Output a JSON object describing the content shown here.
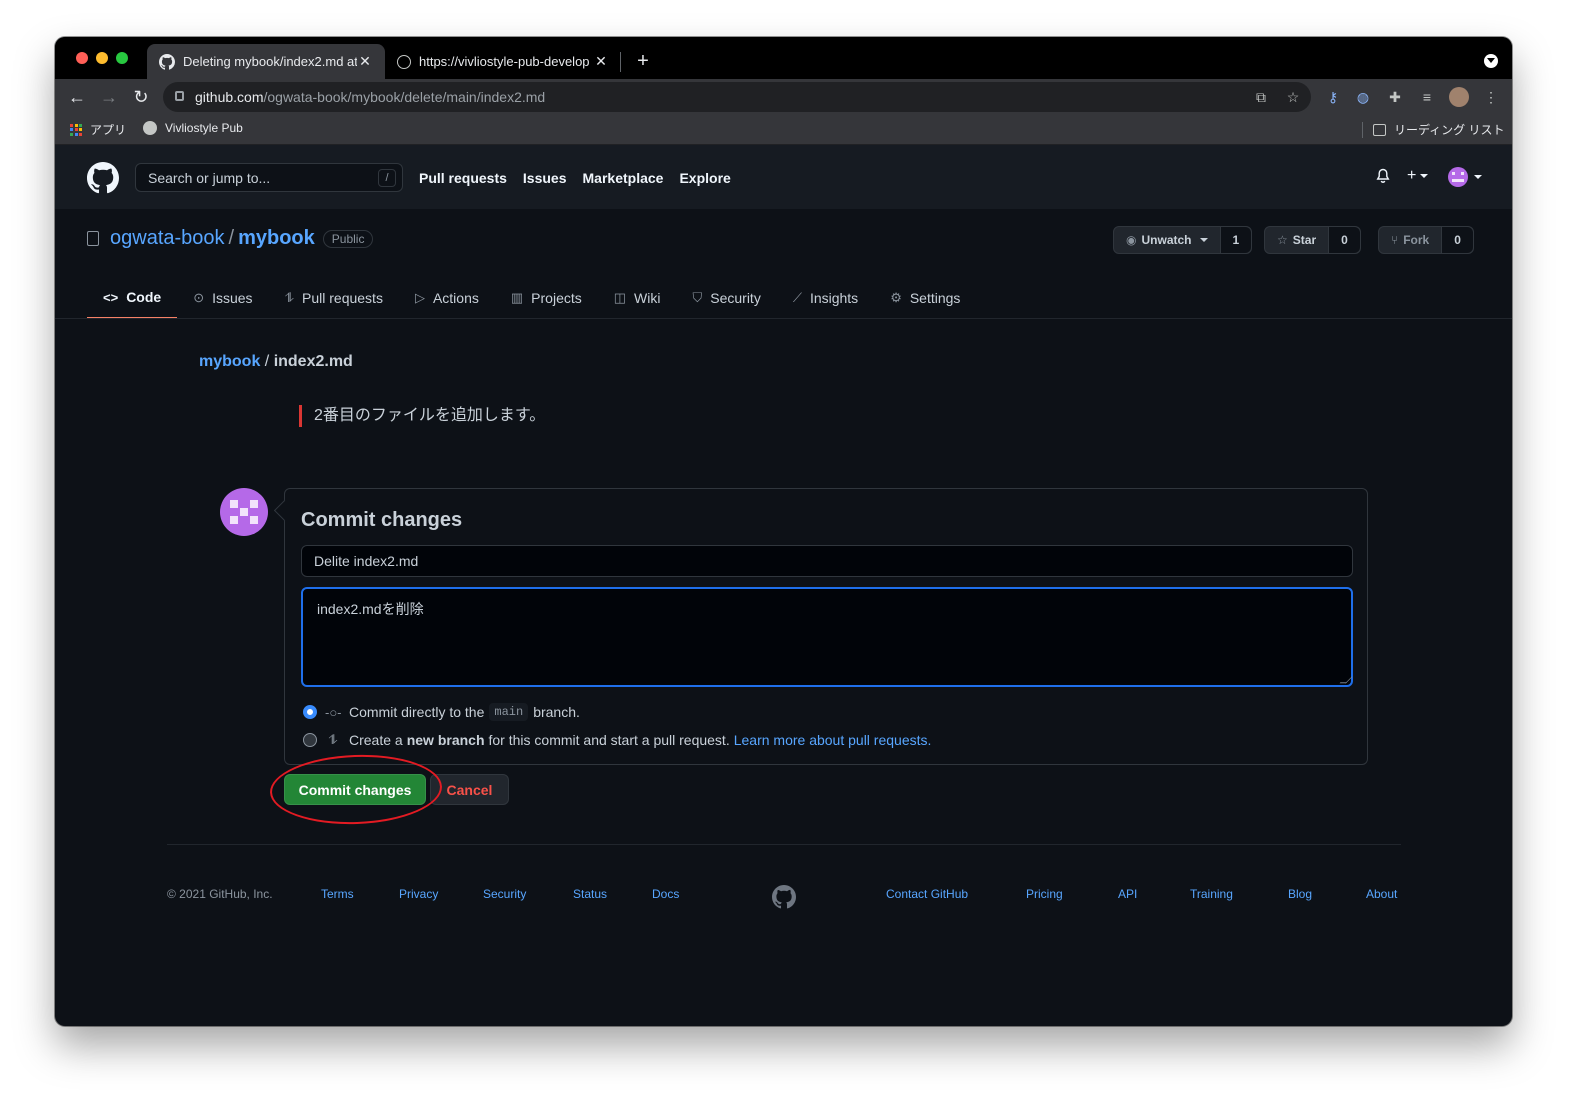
{
  "browser": {
    "tabs": [
      {
        "title": "Deleting mybook/index2.md at",
        "active": true
      },
      {
        "title": "https://vivliostyle-pub-develop",
        "active": false
      }
    ],
    "url_host": "github.com",
    "url_path": "/ogwata-book/mybook/delete/main/index2.md",
    "bookmarks": {
      "apps": "アプリ",
      "vivliostyle": "Vivliostyle Pub",
      "reading_list": "リーディング リスト"
    }
  },
  "gh_header": {
    "search_placeholder": "Search or jump to...",
    "search_key": "/",
    "nav": [
      "Pull requests",
      "Issues",
      "Marketplace",
      "Explore"
    ]
  },
  "repo": {
    "owner": "ogwata-book",
    "separator": "/",
    "name": "mybook",
    "visibility": "Public",
    "watch": {
      "label": "Unwatch",
      "count": "1"
    },
    "star": {
      "label": "Star",
      "count": "0"
    },
    "fork": {
      "label": "Fork",
      "count": "0"
    },
    "tabs": [
      {
        "label": "Code",
        "icon": "code-icon",
        "selected": true
      },
      {
        "label": "Issues",
        "icon": "issue-icon"
      },
      {
        "label": "Pull requests",
        "icon": "pull-request-icon"
      },
      {
        "label": "Actions",
        "icon": "play-icon"
      },
      {
        "label": "Projects",
        "icon": "project-icon"
      },
      {
        "label": "Wiki",
        "icon": "book-icon"
      },
      {
        "label": "Security",
        "icon": "shield-icon"
      },
      {
        "label": "Insights",
        "icon": "graph-icon"
      },
      {
        "label": "Settings",
        "icon": "gear-icon"
      }
    ]
  },
  "content": {
    "breadcrumb_repo": "mybook",
    "breadcrumb_sep": " / ",
    "breadcrumb_file": "index2.md",
    "deleted_line": "2番目のファイルを追加します。"
  },
  "commit": {
    "heading": "Commit changes",
    "summary_value": "Delite index2.md",
    "description_value": "index2.mdを削除",
    "option_direct": {
      "before": "Commit directly to the",
      "branch": "main",
      "after": "branch."
    },
    "option_new": {
      "before": "Create a",
      "bold": "new branch",
      "after": "for this commit and start a pull request.",
      "link": "Learn more about pull requests."
    },
    "commit_button": "Commit changes",
    "cancel_button": "Cancel"
  },
  "footer": {
    "copyright": "© 2021 GitHub, Inc.",
    "left_links": [
      "Terms",
      "Privacy",
      "Security",
      "Status",
      "Docs"
    ],
    "right_links": [
      "Contact GitHub",
      "Pricing",
      "API",
      "Training",
      "Blog",
      "About"
    ]
  },
  "colors": {
    "background": "#0d1117",
    "link": "#58a6ff",
    "primary_button": "#238636",
    "danger": "#f85149",
    "annotation": "#e31b23",
    "avatar": "#b569e8"
  }
}
